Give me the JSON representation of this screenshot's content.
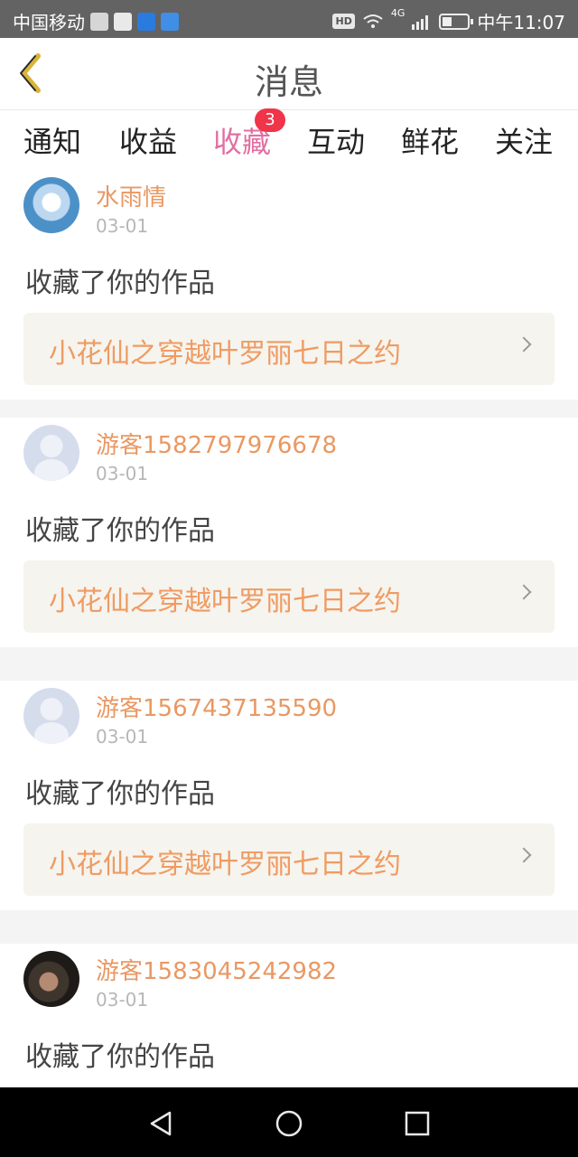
{
  "status_bar": {
    "carrier": "中国移动",
    "hd": "HD",
    "network": "4G",
    "time": "中午11:07",
    "icons": [
      "activity-icon",
      "app-icon",
      "app-icon",
      "app-icon",
      "wifi-icon",
      "signal-icon",
      "battery-icon"
    ]
  },
  "header": {
    "title": "消息",
    "back_icon": "chevron-left-icon"
  },
  "tabs": [
    {
      "label": "通知",
      "active": false
    },
    {
      "label": "收益",
      "active": false
    },
    {
      "label": "收藏",
      "active": true,
      "badge": "3"
    },
    {
      "label": "互动",
      "active": false
    },
    {
      "label": "鲜花",
      "active": false
    },
    {
      "label": "关注",
      "active": false
    }
  ],
  "messages": [
    {
      "username": "水雨情",
      "date": "03-01",
      "action": "收藏了你的作品",
      "work_title": "小花仙之穿越叶罗丽七日之约"
    },
    {
      "username": "游客1582797976678",
      "date": "03-01",
      "action": "收藏了你的作品",
      "work_title": "小花仙之穿越叶罗丽七日之约"
    },
    {
      "username": "游客1567437135590",
      "date": "03-01",
      "action": "收藏了你的作品",
      "work_title": "小花仙之穿越叶罗丽七日之约"
    },
    {
      "username": "游客1583045242982",
      "date": "03-01",
      "action": "收藏了你的作品",
      "work_title": ""
    }
  ],
  "colors": {
    "accent_pink": "#e070a2",
    "username_orange": "#e99863",
    "badge_red": "#f0344a",
    "link_bg": "#f6f4ee"
  }
}
